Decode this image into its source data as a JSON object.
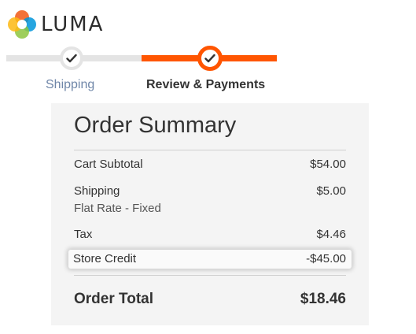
{
  "brand": {
    "name": "LUMA",
    "logo_colors": [
      "#f26322",
      "#8dc63f",
      "#0095da",
      "#fdb813"
    ]
  },
  "checkout_progress": {
    "steps": [
      {
        "label": "Shipping",
        "status": "complete"
      },
      {
        "label": "Review & Payments",
        "status": "active"
      }
    ],
    "colors": {
      "active": "#ff5501",
      "inactive": "#e4e4e4"
    }
  },
  "order_summary": {
    "title": "Order Summary",
    "rows": [
      {
        "label": "Cart Subtotal",
        "value": "$54.00"
      },
      {
        "label": "Shipping",
        "sublabel": "Flat Rate - Fixed",
        "value": "$5.00"
      },
      {
        "label": "Tax",
        "value": "$4.46"
      },
      {
        "label": "Store Credit",
        "value": "-$45.00"
      }
    ],
    "total": {
      "label": "Order Total",
      "value": "$18.46"
    }
  }
}
